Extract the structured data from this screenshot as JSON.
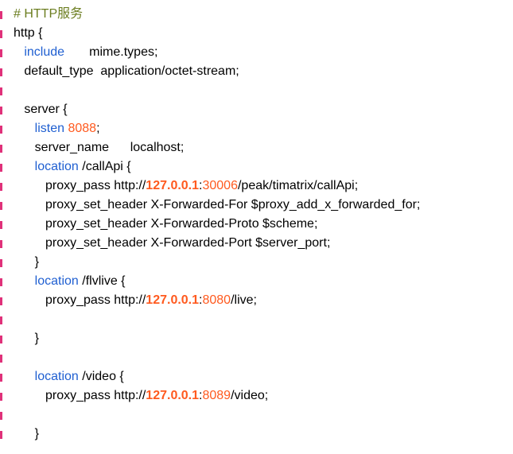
{
  "editor": {
    "lines": [
      [
        {
          "t": "# HTTP服务",
          "c": "comment"
        }
      ],
      [
        {
          "t": "http {",
          "c": "plain"
        }
      ],
      [
        {
          "t": "   ",
          "c": "plain"
        },
        {
          "t": "include",
          "c": "kw"
        },
        {
          "t": "       mime.types;",
          "c": "plain"
        }
      ],
      [
        {
          "t": "   default_type  application/octet-stream;",
          "c": "plain"
        }
      ],
      [],
      [
        {
          "t": "   server {",
          "c": "plain"
        }
      ],
      [
        {
          "t": "      ",
          "c": "plain"
        },
        {
          "t": "listen",
          "c": "kw"
        },
        {
          "t": " ",
          "c": "plain"
        },
        {
          "t": "8088",
          "c": "num"
        },
        {
          "t": ";",
          "c": "plain"
        }
      ],
      [
        {
          "t": "      server_name      localhost;",
          "c": "plain"
        }
      ],
      [
        {
          "t": "      ",
          "c": "plain"
        },
        {
          "t": "location",
          "c": "kw"
        },
        {
          "t": " /callApi {",
          "c": "plain"
        }
      ],
      [
        {
          "t": "         proxy_pass http://",
          "c": "plain"
        },
        {
          "t": "127.0.0.1",
          "c": "ip"
        },
        {
          "t": ":",
          "c": "plain"
        },
        {
          "t": "30006",
          "c": "num"
        },
        {
          "t": "/peak/timatrix/callApi;",
          "c": "plain"
        }
      ],
      [
        {
          "t": "         proxy_set_header X-Forwarded-For $proxy_add_x_forwarded_for;",
          "c": "plain"
        }
      ],
      [
        {
          "t": "         proxy_set_header X-Forwarded-Proto $scheme;",
          "c": "plain"
        }
      ],
      [
        {
          "t": "         proxy_set_header X-Forwarded-Port $server_port;",
          "c": "plain"
        }
      ],
      [
        {
          "t": "      }",
          "c": "plain"
        }
      ],
      [
        {
          "t": "      ",
          "c": "plain"
        },
        {
          "t": "location",
          "c": "kw"
        },
        {
          "t": " /flvlive {",
          "c": "plain"
        }
      ],
      [
        {
          "t": "         proxy_pass http://",
          "c": "plain"
        },
        {
          "t": "127.0.0.1",
          "c": "ip"
        },
        {
          "t": ":",
          "c": "plain"
        },
        {
          "t": "8080",
          "c": "num"
        },
        {
          "t": "/live;",
          "c": "plain"
        }
      ],
      [],
      [
        {
          "t": "      }",
          "c": "plain"
        }
      ],
      [],
      [
        {
          "t": "      ",
          "c": "plain"
        },
        {
          "t": "location",
          "c": "kw"
        },
        {
          "t": " /video {",
          "c": "plain"
        }
      ],
      [
        {
          "t": "         proxy_pass http://",
          "c": "plain"
        },
        {
          "t": "127.0.0.1",
          "c": "ip"
        },
        {
          "t": ":",
          "c": "plain"
        },
        {
          "t": "8089",
          "c": "num"
        },
        {
          "t": "/video;",
          "c": "plain"
        }
      ],
      [],
      [
        {
          "t": "      }",
          "c": "plain"
        }
      ]
    ]
  },
  "colors": {
    "comment": "#6b7d1f",
    "keyword": "#1f5fd1",
    "number": "#ff5a1f",
    "gutter_mark": "#e0317a"
  }
}
